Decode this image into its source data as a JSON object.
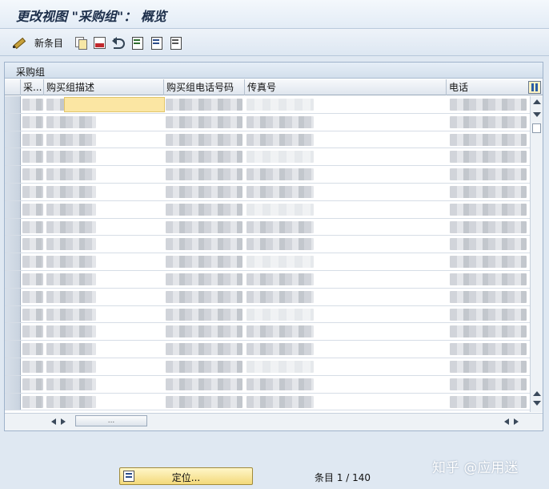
{
  "window": {
    "title": "更改视图 \"采购组\"： 概览"
  },
  "toolbar": {
    "items": [
      {
        "icon": "pencil-icon",
        "label": ""
      },
      {
        "icon": "new-entries-icon",
        "label": "新条目"
      },
      {
        "icon": "copy-icon",
        "label": ""
      },
      {
        "icon": "delete-icon",
        "label": ""
      },
      {
        "icon": "undo-icon",
        "label": ""
      },
      {
        "icon": "select-all-icon",
        "label": ""
      },
      {
        "icon": "select-block-icon",
        "label": ""
      },
      {
        "icon": "deselect-all-icon",
        "label": ""
      }
    ]
  },
  "table": {
    "title": "采购组",
    "columns": [
      "采...",
      "购买组描述",
      "购买组电话号码",
      "传真号",
      "电话"
    ],
    "row_count_visible": 18
  },
  "footer": {
    "locate_label": "定位...",
    "entry_label": "条目",
    "entry_current": "1",
    "entry_total": "140",
    "entry_text": "条目 1 / 140"
  },
  "watermark": {
    "text": "知乎 @应用迷"
  },
  "colors": {
    "background": "#dfe8f2",
    "header_gradient_top": "#e6eef7",
    "active_cell": "#fbe6a3",
    "button": "#f3d97a"
  }
}
